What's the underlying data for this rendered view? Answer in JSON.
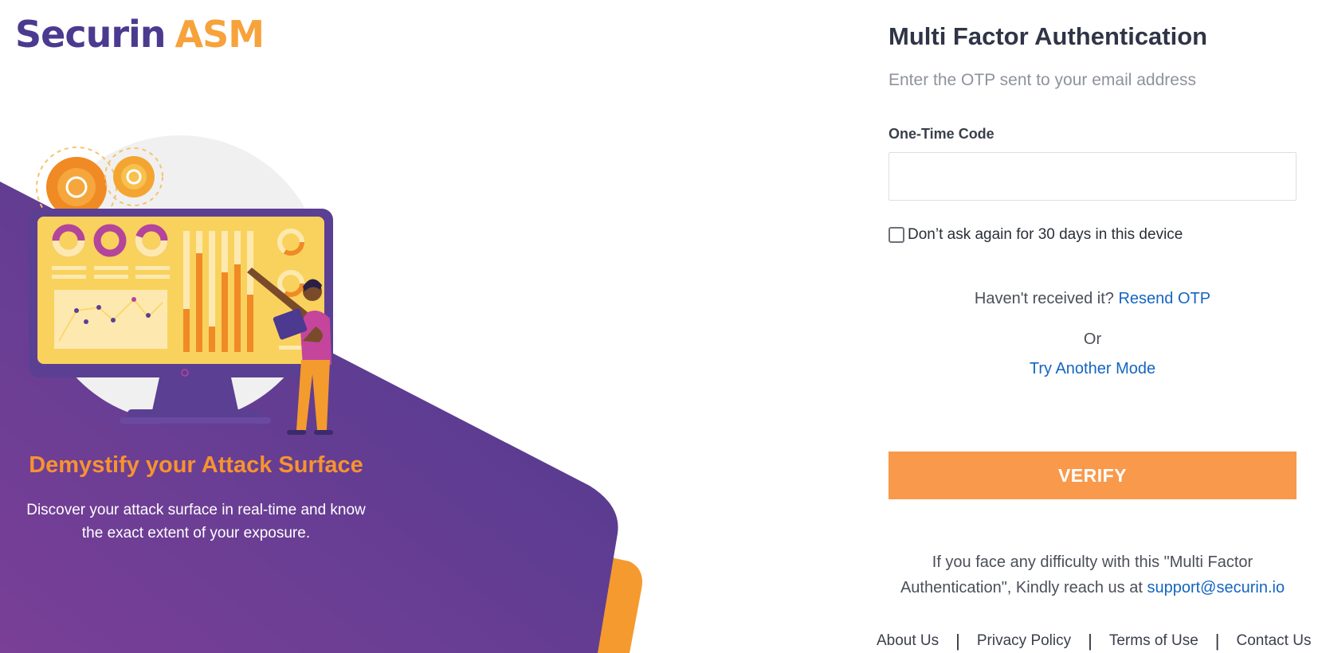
{
  "brand": {
    "name_main": "Securin",
    "name_accent": "ASM"
  },
  "hero": {
    "title": "Demystify your Attack Surface",
    "description": "Discover your attack surface in real-time and know the exact extent of your exposure."
  },
  "mfa": {
    "title": "Multi Factor Authentication",
    "subtitle": "Enter the OTP sent to your email address",
    "otp_label": "One-Time Code",
    "otp_value": "",
    "remember_label": "Don’t ask again for 30 days in this device",
    "remember_checked": false,
    "resend_question": "Haven't received it?",
    "resend_link": "Resend OTP",
    "or_text": "Or",
    "try_another": "Try Another Mode",
    "verify_label": "VERIFY",
    "help_text": "If you face any difficulty with this \"Multi Factor Authentication\", Kindly reach us at",
    "support_email": "support@securin.io"
  },
  "footer": {
    "links": [
      "About Us",
      "Privacy Policy",
      "Terms of Use",
      "Contact Us"
    ]
  },
  "colors": {
    "brand_purple": "#4b3a8f",
    "brand_orange": "#f7a23b",
    "verify_button": "#f9994b",
    "link_blue": "#1565c0"
  },
  "icons": {
    "illustration": "monitor-dashboard-illustration",
    "gears": "gear-icon"
  }
}
